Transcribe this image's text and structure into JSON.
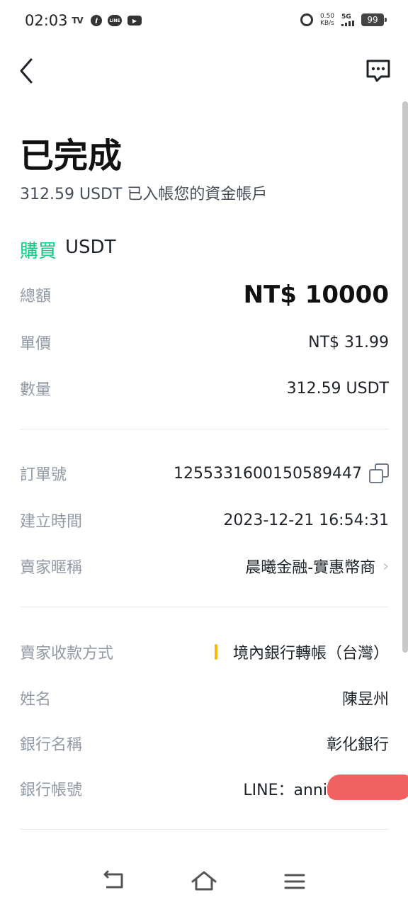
{
  "status_bar": {
    "time": "02:03",
    "net_speed_value": "0.50",
    "net_speed_unit": "KB/s",
    "network": "5G",
    "battery": "99",
    "icons_left": [
      "tv-icon",
      "info-icon",
      "line-icon",
      "youtube-icon"
    ],
    "icons_right": [
      "alarm-icon",
      "signal-icon",
      "battery-icon"
    ]
  },
  "nav": {
    "back_icon": "chevron-left-icon",
    "chat_icon": "chat-bubble-icon"
  },
  "header": {
    "title": "已完成",
    "subtitle": "312.59 USDT 已入帳您的資金帳戶"
  },
  "order": {
    "side": "購買",
    "coin": "USDT",
    "side_color": "#0ecb81",
    "total_label": "總額",
    "total_value": "NT$ 10000",
    "price_label": "單價",
    "price_value": "NT$ 31.99",
    "quantity_label": "數量",
    "quantity_value": "312.59 USDT"
  },
  "details": {
    "order_no_label": "訂單號",
    "order_no_value": "1255331600150589447",
    "created_label": "建立時間",
    "created_value": "2023-12-21 16:54:31",
    "seller_label": "賣家暱稱",
    "seller_value": "晨曦金融-實惠幣商"
  },
  "payment": {
    "method_label": "賣家收款方式",
    "method_value": "境內銀行轉帳（台灣）",
    "method_marker_color": "#f0b90b",
    "name_label": "姓名",
    "name_value": "陳昱州",
    "bank_label": "銀行名稱",
    "bank_value": "彰化銀行",
    "account_label": "銀行帳號",
    "account_value": "LINE：anni"
  },
  "bottom_nav": {
    "icons": [
      "back-nav-icon",
      "home-icon",
      "menu-icon"
    ]
  }
}
